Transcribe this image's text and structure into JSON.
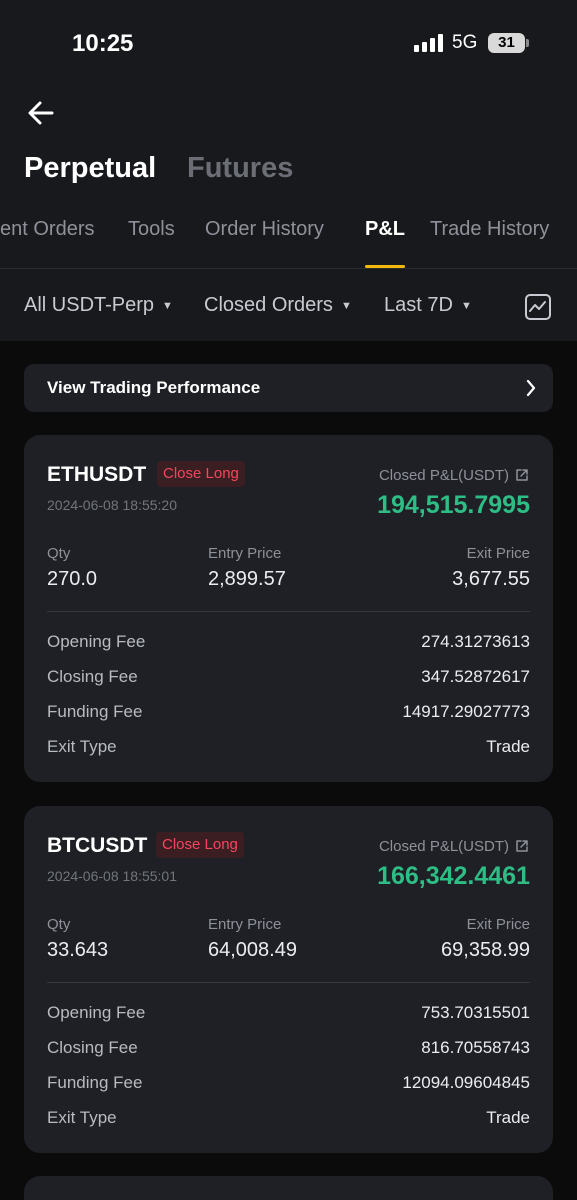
{
  "status_bar": {
    "time": "10:25",
    "network": "5G",
    "battery": "31"
  },
  "header": {
    "title_tabs": [
      {
        "label": "Perpetual",
        "active": true
      },
      {
        "label": "Futures",
        "active": false
      }
    ],
    "sub_tabs": [
      {
        "label": "ent Orders",
        "active": false
      },
      {
        "label": "Tools",
        "active": false
      },
      {
        "label": "Order History",
        "active": false
      },
      {
        "label": "P&L",
        "active": true
      },
      {
        "label": "Trade History",
        "active": false
      }
    ]
  },
  "filters": {
    "contract": "All USDT-Perp",
    "order_type": "Closed Orders",
    "period": "Last 7D"
  },
  "performance": {
    "label": "View Trading Performance"
  },
  "accent_colors": {
    "profit": "#2ebd85",
    "loss": "#f6465d",
    "tab_indicator": "#f0b90b"
  },
  "positions": [
    {
      "symbol": "ETHUSDT",
      "side": "Close Long",
      "time": "2024-06-08 18:55:20",
      "pnl_label": "Closed P&L(USDT)",
      "pnl": "194,515.7995",
      "qty_label": "Qty",
      "qty": "270.0",
      "entry_label": "Entry Price",
      "entry": "2,899.57",
      "exit_label": "Exit Price",
      "exit": "3,677.55",
      "fees": [
        {
          "label": "Opening Fee",
          "value": "274.31273613"
        },
        {
          "label": "Closing Fee",
          "value": "347.52872617"
        },
        {
          "label": "Funding Fee",
          "value": "14917.29027773"
        },
        {
          "label": "Exit Type",
          "value": "Trade"
        }
      ]
    },
    {
      "symbol": "BTCUSDT",
      "side": "Close Long",
      "time": "2024-06-08 18:55:01",
      "pnl_label": "Closed P&L(USDT)",
      "pnl": "166,342.4461",
      "qty_label": "Qty",
      "qty": "33.643",
      "entry_label": "Entry Price",
      "entry": "64,008.49",
      "exit_label": "Exit Price",
      "exit": "69,358.99",
      "fees": [
        {
          "label": "Opening Fee",
          "value": "753.70315501"
        },
        {
          "label": "Closing Fee",
          "value": "816.70558743"
        },
        {
          "label": "Funding Fee",
          "value": "12094.09604845"
        },
        {
          "label": "Exit Type",
          "value": "Trade"
        }
      ]
    }
  ]
}
